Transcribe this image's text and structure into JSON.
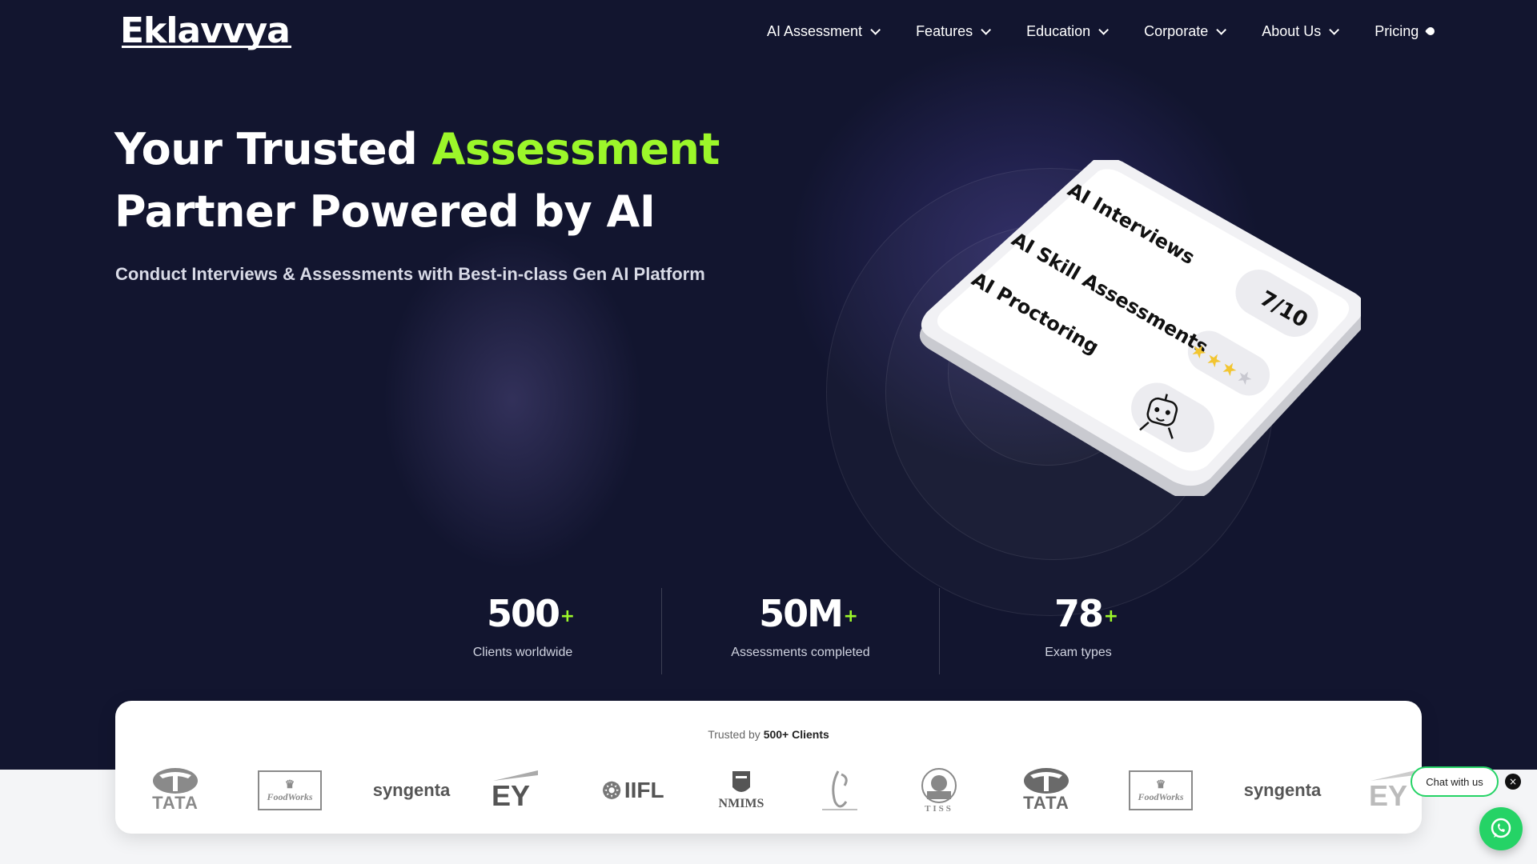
{
  "brand": {
    "logo_text": "Eklavvya"
  },
  "nav": {
    "items": [
      {
        "label": "AI Assessment",
        "icon": "chevron-down-icon"
      },
      {
        "label": "Features",
        "icon": "chevron-down-icon"
      },
      {
        "label": "Education",
        "icon": "chevron-down-icon"
      },
      {
        "label": "Corporate",
        "icon": "chevron-down-icon"
      },
      {
        "label": "About Us",
        "icon": "chevron-down-icon"
      },
      {
        "label": "Pricing",
        "icon": "tag-icon"
      }
    ]
  },
  "hero": {
    "headline_part1": "Your Trusted ",
    "headline_accent": "Assessment",
    "headline_part2": "Partner Powered by AI",
    "subheadline": "Conduct Interviews & Assessments with Best-in-class Gen AI Platform",
    "accent_color": "#9cf72a"
  },
  "illustration": {
    "lines": [
      "AI Interviews",
      "AI Skill Assessments",
      "AI Proctoring"
    ],
    "score": "7/10",
    "stars_filled": 3,
    "stars_total": 4,
    "icon": "robot-icon"
  },
  "stats": [
    {
      "value": "500",
      "plus": "+",
      "label": "Clients worldwide"
    },
    {
      "value": "50M",
      "plus": "+",
      "label": "Assessments completed"
    },
    {
      "value": "78",
      "plus": "+",
      "label": "Exam types"
    }
  ],
  "clients": {
    "title_prefix": "Trusted by ",
    "title_bold": "500+ Clients",
    "logos": [
      "TATA",
      "FoodWorks",
      "syngenta",
      "EY",
      "IIFL",
      "NMIMS",
      "university-seal",
      "TISS",
      "TATA",
      "FoodWorks",
      "syngenta",
      "EY"
    ]
  },
  "chat": {
    "pill_label": "Chat with us",
    "close_label": "×",
    "whatsapp_icon": "whatsapp-icon"
  }
}
